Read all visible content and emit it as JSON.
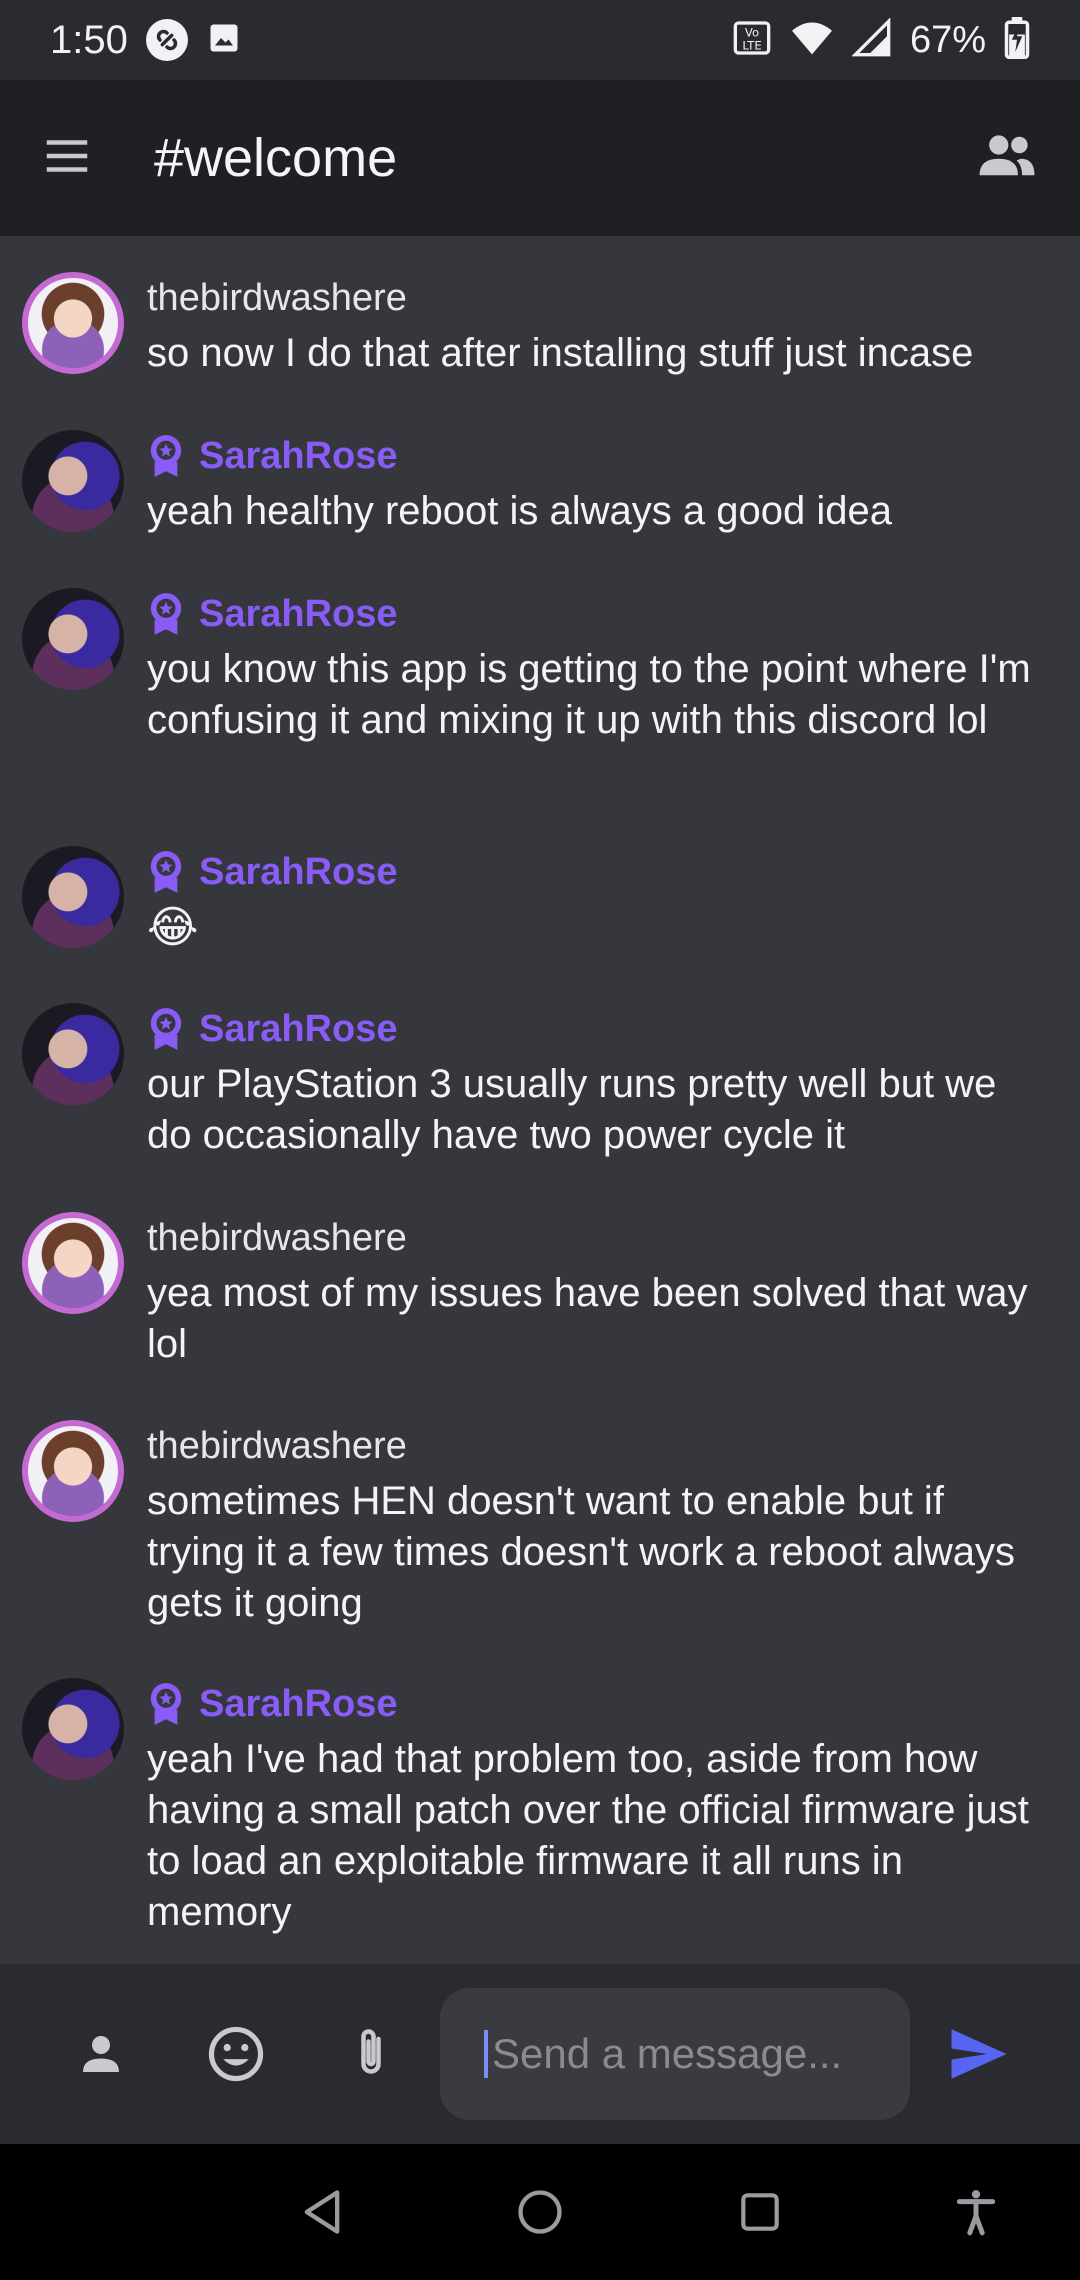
{
  "status_bar": {
    "time": "1:50",
    "battery_percent": "67%",
    "icons": [
      "vpn-icon",
      "image-icon",
      "volte-icon",
      "wifi-icon",
      "signal-icon",
      "battery-charging-icon"
    ]
  },
  "app_bar": {
    "title": "#welcome",
    "icons": [
      "menu-icon",
      "members-icon"
    ]
  },
  "colors": {
    "background": "#36373d",
    "app_bar": "#1f2023",
    "accent_moderator": "#8a5cf6",
    "send": "#5865f2"
  },
  "messages": [
    {
      "author": "thebirdwashere",
      "role": "member",
      "text": "so now I do that after installing stuff just incase"
    },
    {
      "author": "SarahRose",
      "role": "moderator",
      "text": "yeah healthy reboot is always a good idea"
    },
    {
      "author": "SarahRose",
      "role": "moderator",
      "text": "you know this app is getting to the point where I'm confusing it and mixing it up with this discord lol"
    },
    {
      "author": "SarahRose",
      "role": "moderator",
      "text": "😂"
    },
    {
      "author": "SarahRose",
      "role": "moderator",
      "text": "our PlayStation 3 usually runs pretty well but we do occasionally have two power cycle it"
    },
    {
      "author": "thebirdwashere",
      "role": "member",
      "text": "yea most of my issues have been solved that way lol"
    },
    {
      "author": "thebirdwashere",
      "role": "member",
      "text": "sometimes HEN doesn't want to enable but if trying it a few times doesn't work a reboot always gets it going"
    },
    {
      "author": "SarahRose",
      "role": "moderator",
      "text": "yeah I've had that problem too, aside from how having a small patch over the official firmware just to load an exploitable firmware it all runs in memory"
    }
  ],
  "composer": {
    "placeholder": "Send a message...",
    "value": "",
    "icons": [
      "profile-icon",
      "emoji-icon",
      "attach-icon",
      "send-icon"
    ]
  },
  "nav_bar": {
    "icons": [
      "back-icon",
      "home-icon",
      "recents-icon",
      "accessibility-icon"
    ]
  }
}
